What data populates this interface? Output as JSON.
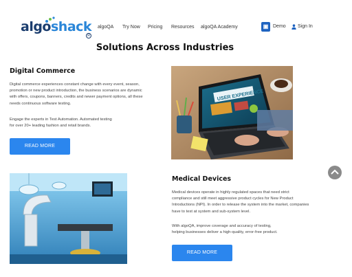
{
  "header": {
    "logo_text_prefix": "algo",
    "logo_text_suffix": "shack",
    "logo_reg": "R",
    "nav": [
      "algoQA",
      "Try Now",
      "Pricing",
      "Resources",
      "algoQA Academy"
    ],
    "demo_label": "Demo",
    "signin_label": "Sign In"
  },
  "section_title": "Solutions Across Industries",
  "digital_commerce": {
    "heading": "Digital Commerce",
    "para1": [
      "Digital commerce experiences constant change with every event, season,",
      "promotion or new product introduction, the business scenarios are dynamic",
      "with offers, coupons, banners, credits and newer payment options, all these",
      "needs continuous software testing."
    ],
    "para2": [
      "Engage the experts in Test Automation. Automated testing",
      "for over 20+ leading fashion and retail brands."
    ],
    "button": "READ MORE",
    "image_text": "USER EXPERIENCE"
  },
  "medical_devices": {
    "heading": "Medical Devices",
    "para1": [
      "Medical devices operate in highly regulated spaces that need strict",
      "compliance and still meet aggressive product cycles for New Product",
      "Introductions (NPI). In order to release the system into the market, companies",
      "have to test at system and sub-system level."
    ],
    "para2": [
      "With algoQA, improve coverage and accuracy of testing,",
      "helping businesses deliver a high-quality, error-free product."
    ],
    "button": "READ MORE"
  },
  "colors": {
    "brand_dark": "#1b3d6e",
    "brand_accent": "#2a86d8",
    "button": "#2b86ee",
    "scroll_top": "#8a8a8a"
  },
  "icons": [
    "logo-dots-icon",
    "demo-icon",
    "user-icon",
    "chevron-up-icon"
  ]
}
